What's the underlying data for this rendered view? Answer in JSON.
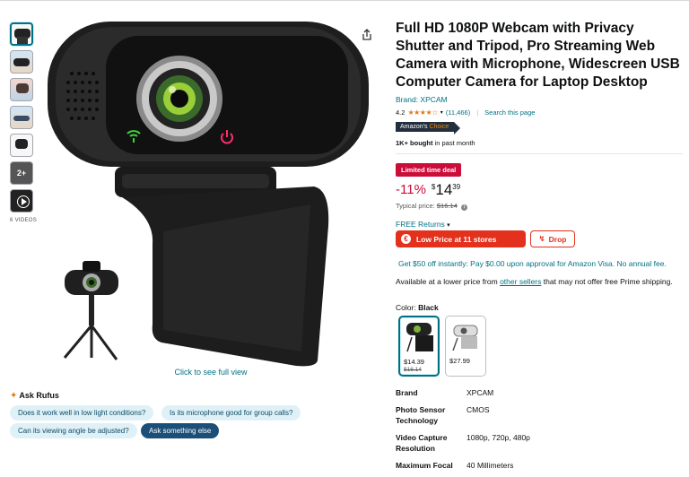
{
  "product": {
    "title": "Full HD 1080P Webcam with Privacy Shutter and Tripod, Pro Streaming Web Camera with Microphone, Widescreen USB Computer Camera for Laptop Desktop",
    "brand_link": "Brand: XPCAM",
    "rating": "4.2",
    "stars": "★★★★☆",
    "review_count": "(11,466)",
    "search_page": "Search this page",
    "choice_badge_a": "Amazon's",
    "choice_badge_b": "Choice",
    "bought_count": "1K+ bought",
    "bought_suffix": "in past month",
    "deal_badge": "Limited time deal",
    "discount": "-11%",
    "currency": "$",
    "price_whole": "14",
    "price_fraction": "39",
    "typical_label": "Typical price:",
    "typical_price": "$16.14",
    "returns": "FREE Returns",
    "low_price_label": "Low Price at 11 stores",
    "drop_label": "Drop",
    "promo": "Get $50 off instantly: Pay $0.00 upon approval for Amazon Visa. No annual fee.",
    "lower_price_prefix": "Available at a lower price from",
    "other_sellers": "other sellers",
    "lower_price_suffix": "that may not offer free Prime shipping.",
    "color_label": "Color:",
    "color_value": "Black",
    "swatches": [
      {
        "price": "$14.39",
        "old": "$16.14"
      },
      {
        "price": "$27.99",
        "old": ""
      }
    ]
  },
  "gallery": {
    "videos_label": "6 VIDEOS",
    "more_label": "2+",
    "click_full": "Click to see full view"
  },
  "rufus": {
    "title": "Ask Rufus",
    "chips": [
      "Does it work well in low light conditions?",
      "Is its microphone good for group calls?",
      "Can its viewing angle be adjusted?",
      "Ask something else"
    ]
  },
  "specs": [
    {
      "key": "Brand",
      "value": "XPCAM"
    },
    {
      "key": "Photo Sensor Technology",
      "value": "CMOS"
    },
    {
      "key": "Video Capture Resolution",
      "value": "1080p, 720p, 480p"
    },
    {
      "key": "Maximum Focal",
      "value": "40 Millimeters"
    }
  ],
  "colors": {
    "link": "#007185",
    "deal_red": "#cc0c39",
    "star_orange": "#de7921",
    "low_price_red": "#e3311d"
  }
}
